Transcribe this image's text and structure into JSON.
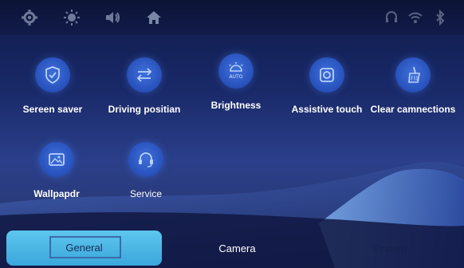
{
  "status_bar": {
    "left_icons": [
      "settings-icon",
      "brightness-icon",
      "volume-icon",
      "home-icon"
    ],
    "right_icons": [
      "headset-icon",
      "wifi-icon",
      "bluetooth-icon"
    ]
  },
  "tiles": [
    {
      "label": "Sereen saver",
      "icon": "shield-check-icon"
    },
    {
      "label": "Driving positian",
      "icon": "swap-arrows-icon"
    },
    {
      "label": "Brightness",
      "icon": "auto-brightness-icon",
      "badge": "AUTO"
    },
    {
      "label": "Assistive touch",
      "icon": "assistive-touch-icon"
    },
    {
      "label": "Clear camnections",
      "icon": "broom-icon"
    },
    {
      "label": "Wallpapdr",
      "icon": "image-icon"
    },
    {
      "label": "Service",
      "icon": "headset-service-icon"
    }
  ],
  "tabs": [
    {
      "label": "General",
      "selected": true
    },
    {
      "label": "Camera",
      "selected": false
    },
    {
      "label": "System",
      "selected": false
    }
  ],
  "colors": {
    "accent": "#3aa7dc",
    "icon_fill": "#2a55c0",
    "text": "#ffffff"
  }
}
